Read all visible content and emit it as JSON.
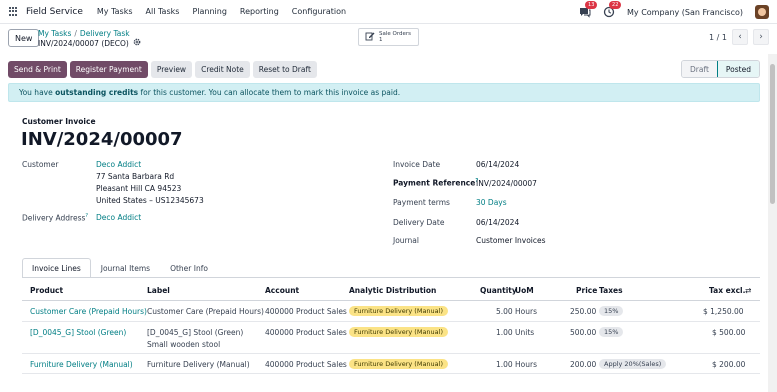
{
  "navbar": {
    "app_name": "Field Service",
    "menu": [
      "My Tasks",
      "All Tasks",
      "Planning",
      "Reporting",
      "Configuration"
    ],
    "chat_badge": "13",
    "activity_badge": "22",
    "company": "My Company (San Francisco)"
  },
  "control": {
    "new_label": "New",
    "breadcrumb": [
      "My Tasks",
      "Delivery Task"
    ],
    "current_record": "INV/2024/00007 (DECO)",
    "smart_button": {
      "label": "Sale Orders",
      "count": "1"
    },
    "pager": "1 / 1"
  },
  "actions": {
    "send_print": "Send & Print",
    "register_payment": "Register Payment",
    "preview": "Preview",
    "credit_note": "Credit Note",
    "reset_draft": "Reset to Draft"
  },
  "status": {
    "draft": "Draft",
    "posted": "Posted"
  },
  "alert": {
    "prefix": "You have ",
    "bold": "outstanding credits",
    "suffix": " for this customer. You can allocate them to mark this invoice as paid."
  },
  "invoice": {
    "type": "Customer Invoice",
    "number": "INV/2024/00007",
    "customer_label": "Customer",
    "customer_name": "Deco Addict",
    "address1": "77 Santa Barbara Rd",
    "address2": "Pleasant Hill CA 94523",
    "address3": "United States – US12345673",
    "delivery_label": "Delivery Address",
    "delivery_value": "Deco Addict",
    "invoice_date_label": "Invoice Date",
    "invoice_date": "06/14/2024",
    "payment_ref_label": "Payment Reference",
    "payment_ref": "INV/2024/00007",
    "payment_terms_label": "Payment terms",
    "payment_terms": "30 Days",
    "delivery_date_label": "Delivery Date",
    "delivery_date": "06/14/2024",
    "journal_label": "Journal",
    "journal": "Customer Invoices"
  },
  "tabs": [
    "Invoice Lines",
    "Journal Items",
    "Other Info"
  ],
  "lines": {
    "headers": {
      "product": "Product",
      "label": "Label",
      "account": "Account",
      "analytic": "Analytic Distribution",
      "quantity": "Quantity",
      "uom": "UoM",
      "price": "Price",
      "taxes": "Taxes",
      "tax_excl": "Tax excl."
    },
    "rows": [
      {
        "product": "Customer Care (Prepaid Hours)",
        "label": "Customer Care (Prepaid Hours)",
        "label2": "",
        "account": "400000 Product Sales",
        "analytic": "Furniture Delivery (Manual)",
        "quantity": "5.00",
        "uom": "Hours",
        "price": "250.00",
        "taxes": "15%",
        "tax_excl": "$ 1,250.00"
      },
      {
        "product": "[D_0045_G] Stool (Green)",
        "label": "[D_0045_G] Stool (Green)",
        "label2": "Small wooden stool",
        "account": "400000 Product Sales",
        "analytic": "Furniture Delivery (Manual)",
        "quantity": "1.00",
        "uom": "Units",
        "price": "500.00",
        "taxes": "15%",
        "tax_excl": "$ 500.00"
      },
      {
        "product": "Furniture Delivery (Manual)",
        "label": "Furniture Delivery (Manual)",
        "label2": "",
        "account": "400000 Product Sales",
        "analytic": "Furniture Delivery (Manual)",
        "quantity": "1.00",
        "uom": "Hours",
        "price": "200.00",
        "taxes": "Apply 20%(Sales)",
        "tax_excl": "$ 200.00"
      }
    ]
  }
}
